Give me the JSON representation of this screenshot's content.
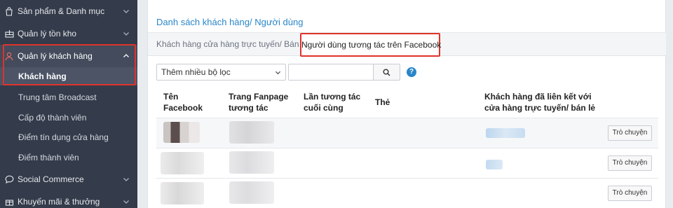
{
  "sidebar": {
    "items": [
      {
        "label": "Sản phẩm & Danh mục",
        "icon": "bag-icon"
      },
      {
        "label": "Quản lý tồn kho",
        "icon": "warehouse-icon"
      },
      {
        "label": "Quản lý khách hàng",
        "icon": "user-icon"
      },
      {
        "label": "Khách hàng"
      },
      {
        "label": "Trung tâm Broadcast"
      },
      {
        "label": "Cấp độ thành viên"
      },
      {
        "label": "Điểm tín dụng cửa hàng"
      },
      {
        "label": "Điểm thành viên"
      },
      {
        "label": "Social Commerce",
        "icon": "chat-icon"
      },
      {
        "label": "Khuyến mãi & thưởng",
        "icon": "gift-icon"
      }
    ]
  },
  "main": {
    "title": "Danh sách khách hàng/ Người dùng",
    "tabs": [
      {
        "label": "Khách hàng cửa hàng trực tuyến/ Bán lẻ"
      },
      {
        "label": "Người dùng tương tác trên Facebook"
      }
    ],
    "filter": {
      "select_value": "Thêm nhiều bộ lọc",
      "search_placeholder": ""
    },
    "help_label": "?",
    "table": {
      "headers": [
        "Tên Facebook",
        "Trang Fanpage tương tác",
        "Lần tương tác cuối cùng",
        "Thẻ",
        "Khách hàng đã liên kết với cửa hàng trực tuyến/ bán lẻ"
      ],
      "chat_label": "Trò chuyện"
    }
  },
  "colors": {
    "sidebar_bg": "#343b4a",
    "accent": "#2a86c8",
    "highlight": "#e0332a"
  }
}
